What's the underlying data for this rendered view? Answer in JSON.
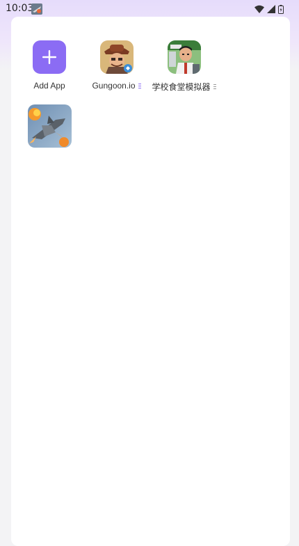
{
  "status_bar": {
    "time": "10:03"
  },
  "apps": [
    {
      "label": "Add App",
      "icon": "plus-icon",
      "color": "#8b6cf4"
    },
    {
      "label": "Gungoon.io",
      "icon": "gungoon-app-icon"
    },
    {
      "label": "学校食堂模拟器",
      "icon": "school-canteen-app-icon"
    },
    {
      "label": "",
      "icon": "jet-fighter-app-icon"
    }
  ],
  "colors": {
    "accent": "#8b6cf4",
    "card": "#ffffff",
    "background": "#f3f3f5"
  }
}
